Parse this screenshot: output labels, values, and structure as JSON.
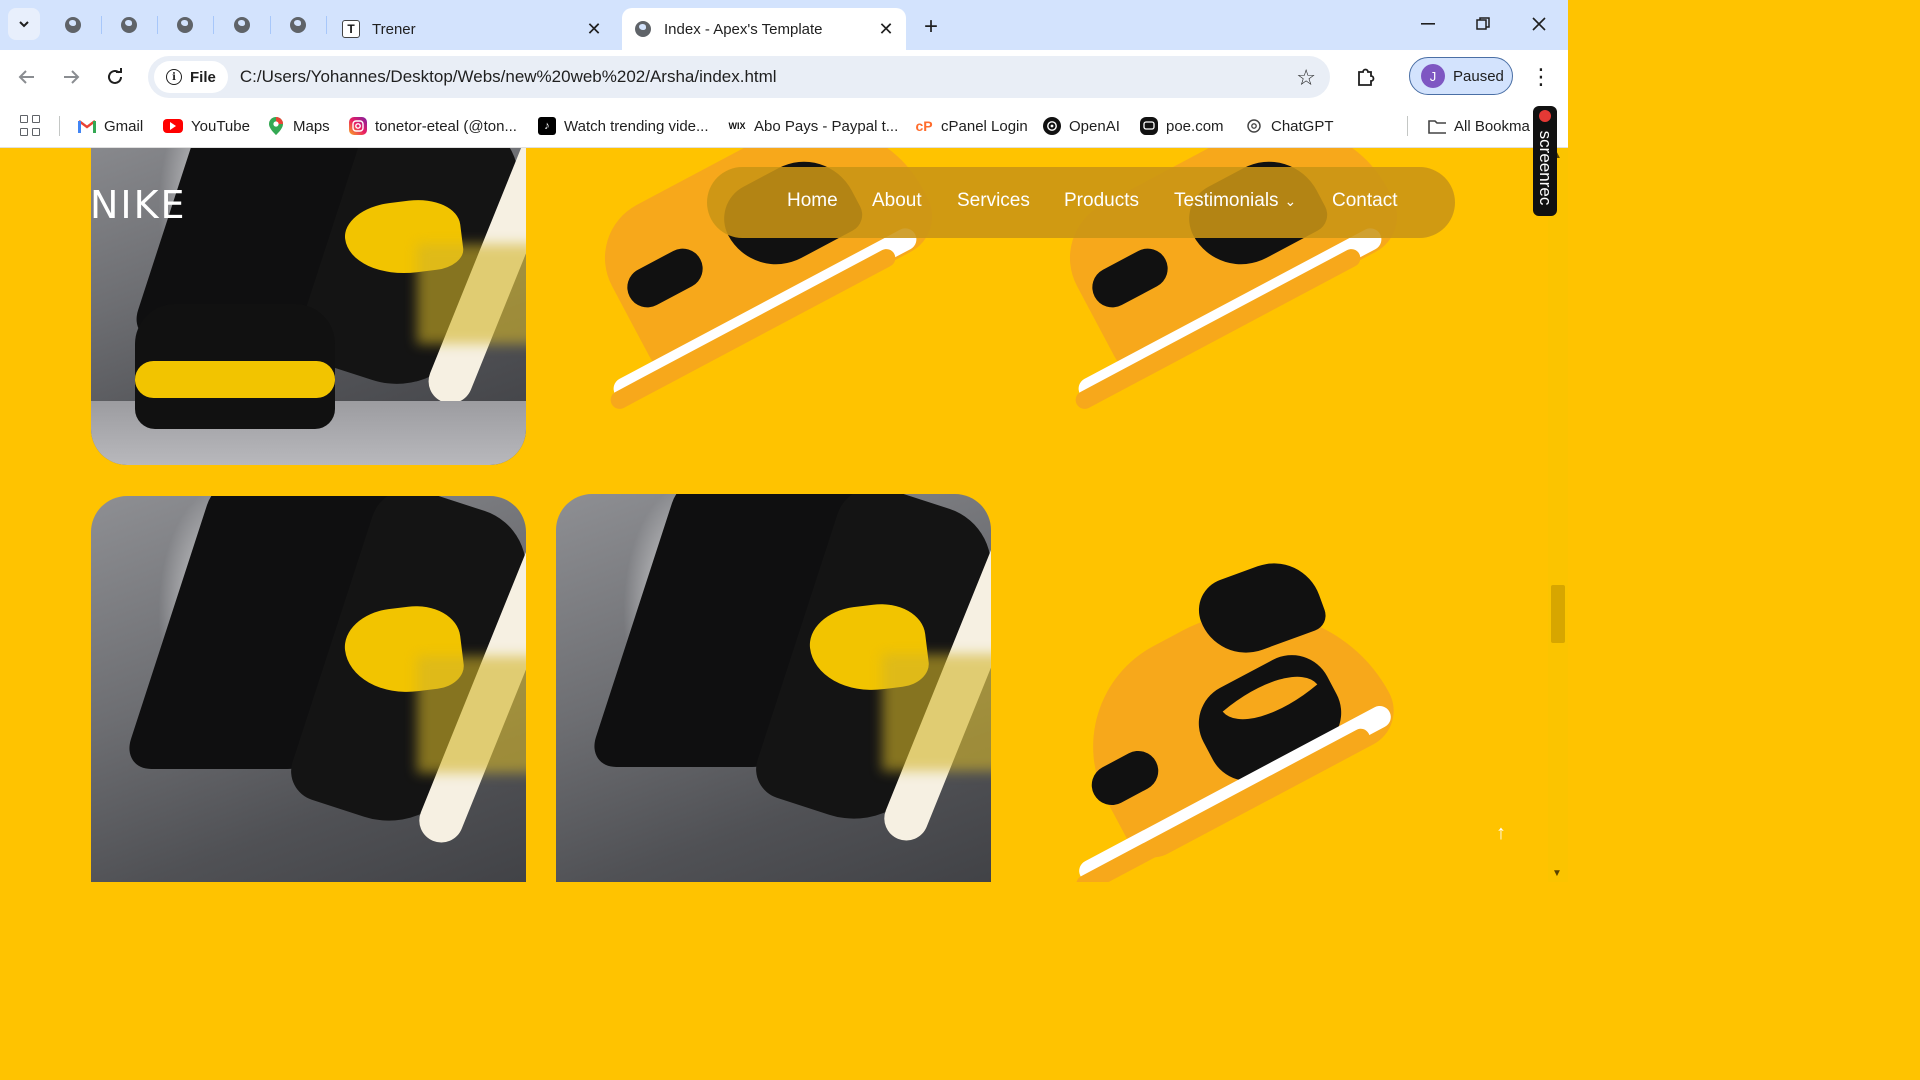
{
  "browser": {
    "tabs": [
      {
        "title": "Trener",
        "favicon": "T"
      },
      {
        "title": "Index - Apex's Template",
        "favicon": "globe"
      }
    ],
    "url": "C:/Users/Yohannes/Desktop/Webs/new%20web%202/Arsha/index.html",
    "site_chip": "File",
    "profile": {
      "initial": "J",
      "label": "Paused"
    },
    "bookmarks": [
      {
        "label": "Gmail"
      },
      {
        "label": "YouTube"
      },
      {
        "label": "Maps"
      },
      {
        "label": "tonetor-eteal (@ton..."
      },
      {
        "label": "Watch trending vide..."
      },
      {
        "label": "Abo Pays - Paypal t..."
      },
      {
        "label": "cPanel Login"
      },
      {
        "label": "OpenAI"
      },
      {
        "label": "poe.com"
      },
      {
        "label": "ChatGPT"
      },
      {
        "label": "All Bookma"
      }
    ],
    "overlay": "screenrec"
  },
  "page": {
    "brand": "NIKE",
    "nav": [
      {
        "label": "Home"
      },
      {
        "label": "About"
      },
      {
        "label": "Services"
      },
      {
        "label": "Products"
      },
      {
        "label": "Testimonials"
      },
      {
        "label": "Contact"
      }
    ],
    "accent_color": "#ffc300",
    "back_to_top_icon": "arrow-up-icon"
  }
}
